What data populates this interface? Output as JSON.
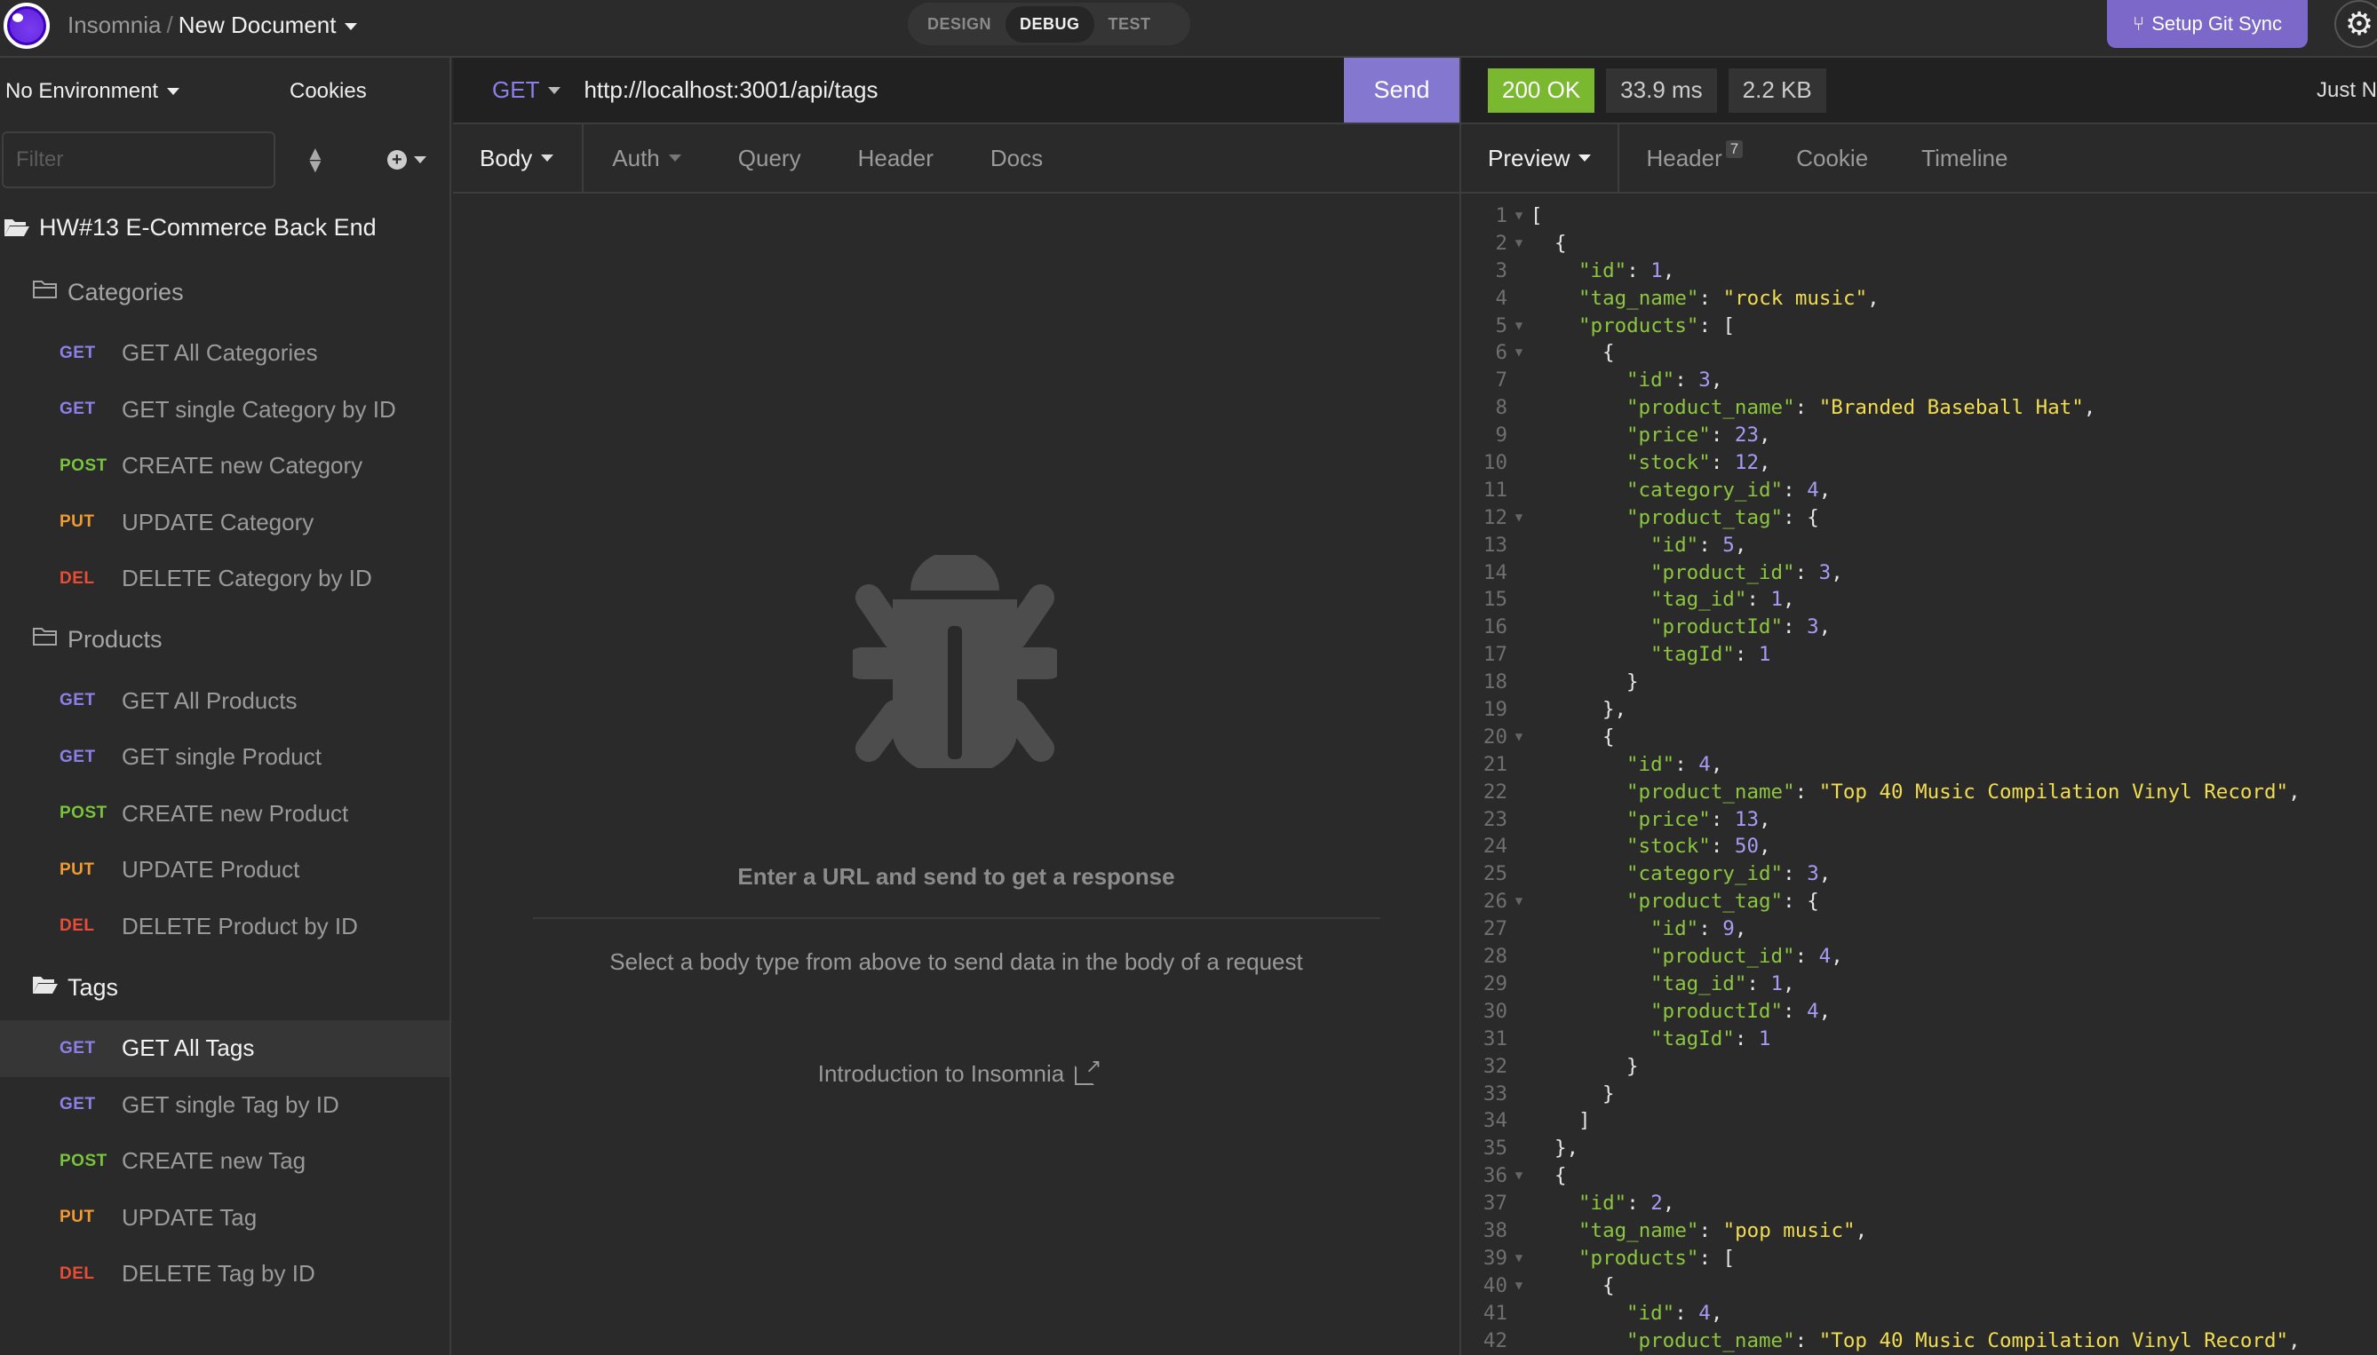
{
  "app": {
    "name": "Insomnia",
    "document": "New Document",
    "modes": [
      "DESIGN",
      "DEBUG",
      "TEST"
    ],
    "active_mode": "DEBUG",
    "git_sync_label": "Setup Git Sync"
  },
  "sidebar": {
    "environment": "No Environment",
    "cookies_label": "Cookies",
    "filter_placeholder": "Filter",
    "workspace": "HW#13 E-Commerce Back End",
    "folders": [
      {
        "name": "Categories",
        "open": false,
        "requests": [
          {
            "method": "GET",
            "name": "GET All Categories"
          },
          {
            "method": "GET",
            "name": "GET single Category by ID"
          },
          {
            "method": "POST",
            "name": "CREATE new Category"
          },
          {
            "method": "PUT",
            "name": "UPDATE Category"
          },
          {
            "method": "DEL",
            "name": "DELETE Category by ID"
          }
        ]
      },
      {
        "name": "Products",
        "open": false,
        "requests": [
          {
            "method": "GET",
            "name": "GET All Products"
          },
          {
            "method": "GET",
            "name": "GET single Product"
          },
          {
            "method": "POST",
            "name": "CREATE new Product"
          },
          {
            "method": "PUT",
            "name": "UPDATE Product"
          },
          {
            "method": "DEL",
            "name": "DELETE Product by ID"
          }
        ]
      },
      {
        "name": "Tags",
        "open": true,
        "requests": [
          {
            "method": "GET",
            "name": "GET All Tags",
            "active": true
          },
          {
            "method": "GET",
            "name": "GET single Tag by ID"
          },
          {
            "method": "POST",
            "name": "CREATE new Tag"
          },
          {
            "method": "PUT",
            "name": "UPDATE Tag"
          },
          {
            "method": "DEL",
            "name": "DELETE Tag by ID"
          }
        ]
      }
    ]
  },
  "request": {
    "method": "GET",
    "url": "http://localhost:3001/api/tags",
    "send_label": "Send",
    "tabs": [
      "Body",
      "Auth",
      "Query",
      "Header",
      "Docs"
    ],
    "empty_title": "Enter a URL and send to get a response",
    "empty_subtitle": "Select a body type from above to send data in the body of a request",
    "intro_link": "Introduction to Insomnia"
  },
  "response": {
    "status": "200 OK",
    "time": "33.9 ms",
    "size": "2.2 KB",
    "timestamp": "Just N",
    "tabs": [
      {
        "label": "Preview"
      },
      {
        "label": "Header",
        "badge": "7"
      },
      {
        "label": "Cookie"
      },
      {
        "label": "Timeline"
      }
    ],
    "lines": [
      {
        "n": "1",
        "f": true,
        "i": 0,
        "t": [
          [
            "p",
            "["
          ]
        ]
      },
      {
        "n": "2",
        "f": true,
        "i": 1,
        "t": [
          [
            "p",
            "{"
          ]
        ]
      },
      {
        "n": "3",
        "i": 2,
        "t": [
          [
            "k",
            "\"id\""
          ],
          [
            "p",
            ": "
          ],
          [
            "n",
            "1"
          ],
          [
            "p",
            ","
          ]
        ]
      },
      {
        "n": "4",
        "i": 2,
        "t": [
          [
            "k",
            "\"tag_name\""
          ],
          [
            "p",
            ": "
          ],
          [
            "s",
            "\"rock music\""
          ],
          [
            "p",
            ","
          ]
        ]
      },
      {
        "n": "5",
        "f": true,
        "i": 2,
        "t": [
          [
            "k",
            "\"products\""
          ],
          [
            "p",
            ": ["
          ]
        ]
      },
      {
        "n": "6",
        "f": true,
        "i": 3,
        "t": [
          [
            "p",
            "{"
          ]
        ]
      },
      {
        "n": "7",
        "i": 4,
        "t": [
          [
            "k",
            "\"id\""
          ],
          [
            "p",
            ": "
          ],
          [
            "n",
            "3"
          ],
          [
            "p",
            ","
          ]
        ]
      },
      {
        "n": "8",
        "i": 4,
        "t": [
          [
            "k",
            "\"product_name\""
          ],
          [
            "p",
            ": "
          ],
          [
            "s",
            "\"Branded Baseball Hat\""
          ],
          [
            "p",
            ","
          ]
        ]
      },
      {
        "n": "9",
        "i": 4,
        "t": [
          [
            "k",
            "\"price\""
          ],
          [
            "p",
            ": "
          ],
          [
            "n",
            "23"
          ],
          [
            "p",
            ","
          ]
        ]
      },
      {
        "n": "10",
        "i": 4,
        "t": [
          [
            "k",
            "\"stock\""
          ],
          [
            "p",
            ": "
          ],
          [
            "n",
            "12"
          ],
          [
            "p",
            ","
          ]
        ]
      },
      {
        "n": "11",
        "i": 4,
        "t": [
          [
            "k",
            "\"category_id\""
          ],
          [
            "p",
            ": "
          ],
          [
            "n",
            "4"
          ],
          [
            "p",
            ","
          ]
        ]
      },
      {
        "n": "12",
        "f": true,
        "i": 4,
        "t": [
          [
            "k",
            "\"product_tag\""
          ],
          [
            "p",
            ": {"
          ]
        ]
      },
      {
        "n": "13",
        "i": 5,
        "t": [
          [
            "k",
            "\"id\""
          ],
          [
            "p",
            ": "
          ],
          [
            "n",
            "5"
          ],
          [
            "p",
            ","
          ]
        ]
      },
      {
        "n": "14",
        "i": 5,
        "t": [
          [
            "k",
            "\"product_id\""
          ],
          [
            "p",
            ": "
          ],
          [
            "n",
            "3"
          ],
          [
            "p",
            ","
          ]
        ]
      },
      {
        "n": "15",
        "i": 5,
        "t": [
          [
            "k",
            "\"tag_id\""
          ],
          [
            "p",
            ": "
          ],
          [
            "n",
            "1"
          ],
          [
            "p",
            ","
          ]
        ]
      },
      {
        "n": "16",
        "i": 5,
        "t": [
          [
            "k",
            "\"productId\""
          ],
          [
            "p",
            ": "
          ],
          [
            "n",
            "3"
          ],
          [
            "p",
            ","
          ]
        ]
      },
      {
        "n": "17",
        "i": 5,
        "t": [
          [
            "k",
            "\"tagId\""
          ],
          [
            "p",
            ": "
          ],
          [
            "n",
            "1"
          ]
        ]
      },
      {
        "n": "18",
        "i": 4,
        "t": [
          [
            "p",
            "}"
          ]
        ]
      },
      {
        "n": "19",
        "i": 3,
        "t": [
          [
            "p",
            "},"
          ]
        ]
      },
      {
        "n": "20",
        "f": true,
        "i": 3,
        "t": [
          [
            "p",
            "{"
          ]
        ]
      },
      {
        "n": "21",
        "i": 4,
        "t": [
          [
            "k",
            "\"id\""
          ],
          [
            "p",
            ": "
          ],
          [
            "n",
            "4"
          ],
          [
            "p",
            ","
          ]
        ]
      },
      {
        "n": "22",
        "i": 4,
        "t": [
          [
            "k",
            "\"product_name\""
          ],
          [
            "p",
            ": "
          ],
          [
            "s",
            "\"Top 40 Music Compilation Vinyl Record\""
          ],
          [
            "p",
            ","
          ]
        ]
      },
      {
        "n": "23",
        "i": 4,
        "t": [
          [
            "k",
            "\"price\""
          ],
          [
            "p",
            ": "
          ],
          [
            "n",
            "13"
          ],
          [
            "p",
            ","
          ]
        ]
      },
      {
        "n": "24",
        "i": 4,
        "t": [
          [
            "k",
            "\"stock\""
          ],
          [
            "p",
            ": "
          ],
          [
            "n",
            "50"
          ],
          [
            "p",
            ","
          ]
        ]
      },
      {
        "n": "25",
        "i": 4,
        "t": [
          [
            "k",
            "\"category_id\""
          ],
          [
            "p",
            ": "
          ],
          [
            "n",
            "3"
          ],
          [
            "p",
            ","
          ]
        ]
      },
      {
        "n": "26",
        "f": true,
        "i": 4,
        "t": [
          [
            "k",
            "\"product_tag\""
          ],
          [
            "p",
            ": {"
          ]
        ]
      },
      {
        "n": "27",
        "i": 5,
        "t": [
          [
            "k",
            "\"id\""
          ],
          [
            "p",
            ": "
          ],
          [
            "n",
            "9"
          ],
          [
            "p",
            ","
          ]
        ]
      },
      {
        "n": "28",
        "i": 5,
        "t": [
          [
            "k",
            "\"product_id\""
          ],
          [
            "p",
            ": "
          ],
          [
            "n",
            "4"
          ],
          [
            "p",
            ","
          ]
        ]
      },
      {
        "n": "29",
        "i": 5,
        "t": [
          [
            "k",
            "\"tag_id\""
          ],
          [
            "p",
            ": "
          ],
          [
            "n",
            "1"
          ],
          [
            "p",
            ","
          ]
        ]
      },
      {
        "n": "30",
        "i": 5,
        "t": [
          [
            "k",
            "\"productId\""
          ],
          [
            "p",
            ": "
          ],
          [
            "n",
            "4"
          ],
          [
            "p",
            ","
          ]
        ]
      },
      {
        "n": "31",
        "i": 5,
        "t": [
          [
            "k",
            "\"tagId\""
          ],
          [
            "p",
            ": "
          ],
          [
            "n",
            "1"
          ]
        ]
      },
      {
        "n": "32",
        "i": 4,
        "t": [
          [
            "p",
            "}"
          ]
        ]
      },
      {
        "n": "33",
        "i": 3,
        "t": [
          [
            "p",
            "}"
          ]
        ]
      },
      {
        "n": "34",
        "i": 2,
        "t": [
          [
            "p",
            "]"
          ]
        ]
      },
      {
        "n": "35",
        "i": 1,
        "t": [
          [
            "p",
            "},"
          ]
        ]
      },
      {
        "n": "36",
        "f": true,
        "i": 1,
        "t": [
          [
            "p",
            "{"
          ]
        ]
      },
      {
        "n": "37",
        "i": 2,
        "t": [
          [
            "k",
            "\"id\""
          ],
          [
            "p",
            ": "
          ],
          [
            "n",
            "2"
          ],
          [
            "p",
            ","
          ]
        ]
      },
      {
        "n": "38",
        "i": 2,
        "t": [
          [
            "k",
            "\"tag_name\""
          ],
          [
            "p",
            ": "
          ],
          [
            "s",
            "\"pop music\""
          ],
          [
            "p",
            ","
          ]
        ]
      },
      {
        "n": "39",
        "f": true,
        "i": 2,
        "t": [
          [
            "k",
            "\"products\""
          ],
          [
            "p",
            ": ["
          ]
        ]
      },
      {
        "n": "40",
        "f": true,
        "i": 3,
        "t": [
          [
            "p",
            "{"
          ]
        ]
      },
      {
        "n": "41",
        "i": 4,
        "t": [
          [
            "k",
            "\"id\""
          ],
          [
            "p",
            ": "
          ],
          [
            "n",
            "4"
          ],
          [
            "p",
            ","
          ]
        ]
      },
      {
        "n": "42",
        "i": 4,
        "t": [
          [
            "k",
            "\"product_name\""
          ],
          [
            "p",
            ": "
          ],
          [
            "s",
            "\"Top 40 Music Compilation Vinyl Record\""
          ],
          [
            "p",
            ","
          ]
        ]
      }
    ]
  },
  "colors": {
    "accent": "#8477cf",
    "status_ok": "#7ab92f",
    "method_get": "#8c80e8",
    "method_post": "#78c43a",
    "method_put": "#f39a2e",
    "method_del": "#ea4d36"
  }
}
